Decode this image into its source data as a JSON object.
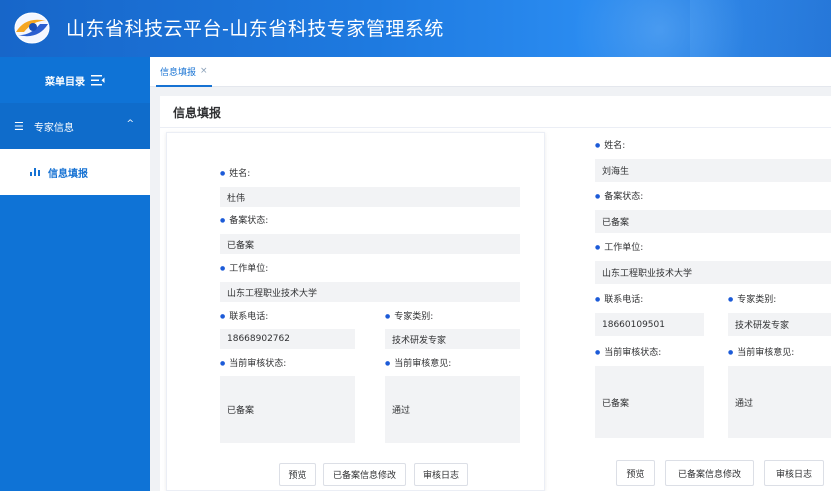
{
  "header": {
    "title": "山东省科技云平台-山东省科技专家管理系统"
  },
  "sidebar": {
    "menu_title": "菜单目录",
    "group": {
      "label": "专家信息",
      "icon": "list-icon"
    },
    "items": [
      {
        "label": "信息填报",
        "icon": "bar-chart-icon"
      }
    ]
  },
  "tabs": [
    {
      "label": "信息填报",
      "close": "×"
    }
  ],
  "page": {
    "title": "信息填报"
  },
  "labels": {
    "name": "姓名:",
    "filing_status": "备案状态:",
    "work_unit": "工作单位:",
    "phone": "联系电话:",
    "expert_type": "专家类别:",
    "review_status": "当前审核状态:",
    "review_opinion": "当前审核意见:"
  },
  "buttons": {
    "preview": "预览",
    "modify": "已备案信息修改",
    "log": "审核日志"
  },
  "records": [
    {
      "name": "杜伟",
      "filing_status": "已备案",
      "work_unit": "山东工程职业技术大学",
      "phone": "18668902762",
      "expert_type": "技术研发专家",
      "review_status": "已备案",
      "review_opinion": "通过"
    },
    {
      "name": "刘海生",
      "filing_status": "已备案",
      "work_unit": "山东工程职业技术大学",
      "phone": "18660109501",
      "expert_type": "技术研发专家",
      "review_status": "已备案",
      "review_opinion": "通过"
    }
  ],
  "colors": {
    "primary": "#1672d3",
    "sidebar": "#0f73d6",
    "header": "#1e7ae0",
    "bullet": "#1c5bd8"
  }
}
